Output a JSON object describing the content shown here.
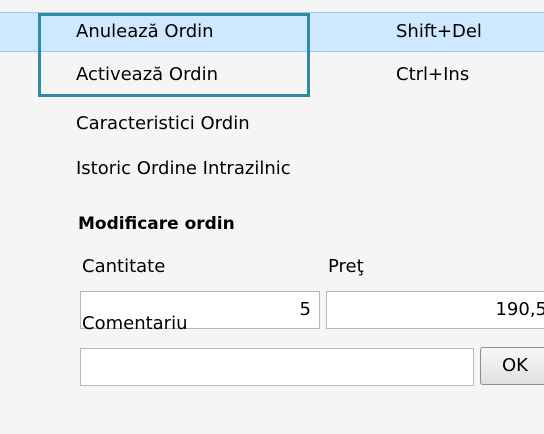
{
  "menu": {
    "items": [
      {
        "label": "Anulează Ordin",
        "shortcut": "Shift+Del"
      },
      {
        "label": "Activează Ordin",
        "shortcut": "Ctrl+Ins"
      },
      {
        "label": "Caracteristici Ordin",
        "shortcut": ""
      },
      {
        "label": "Istoric Ordine Intrazilnic",
        "shortcut": ""
      }
    ]
  },
  "modify_order": {
    "title": "Modificare ordin",
    "quantity": {
      "label": "Cantitate",
      "value": "5"
    },
    "price": {
      "label": "Preţ",
      "value": "190,5"
    },
    "comment": {
      "label": "Comentariu",
      "value": ""
    },
    "ok_label": "OK"
  }
}
